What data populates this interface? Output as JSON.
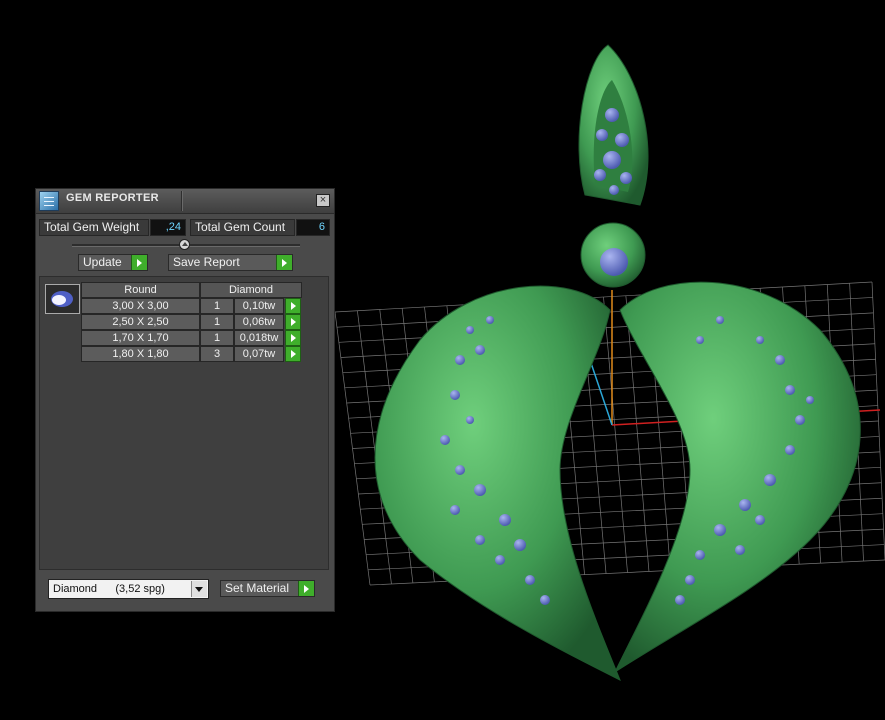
{
  "window": {
    "title": "GEM REPORTER",
    "close_icon": "close-icon"
  },
  "totals": {
    "weight_label": "Total Gem Weight",
    "weight_value": ",24",
    "count_label": "Total Gem Count",
    "count_value": "6"
  },
  "actions": {
    "update_label": "Update",
    "save_label": "Save Report",
    "set_material_label": "Set Material"
  },
  "table": {
    "headers": [
      "Round",
      "Diamond"
    ],
    "rows": [
      {
        "size": "3,00 X 3,00",
        "count": "1",
        "weight": "0,10tw"
      },
      {
        "size": "2,50 X 2,50",
        "count": "1",
        "weight": "0,06tw"
      },
      {
        "size": "1,70 X 1,70",
        "count": "1",
        "weight": "0,018tw"
      },
      {
        "size": "1,80 X 1,80",
        "count": "3",
        "weight": "0,07tw"
      }
    ]
  },
  "material": {
    "selected": "Diamond      (3,52 spg)"
  },
  "colors": {
    "accent_green": "#3fae2b",
    "value_cyan": "#6fd6ff",
    "model_green": "#3f9a52",
    "gem_blue": "#6f7fd0"
  }
}
